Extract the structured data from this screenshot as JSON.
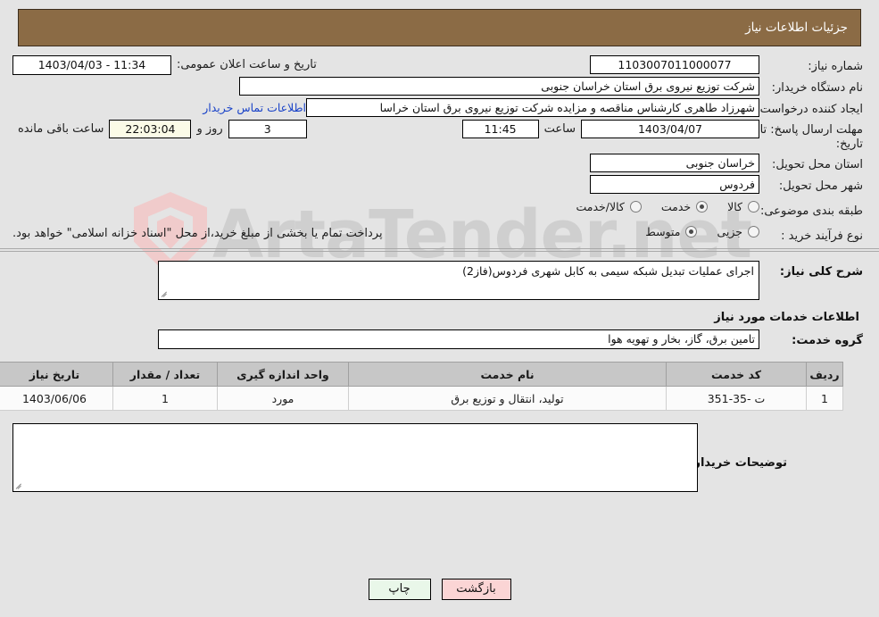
{
  "header": {
    "title": "جزئیات اطلاعات نیاز",
    "bg_color": "#8b6b45",
    "text_color": "#ffffff"
  },
  "watermark": {
    "text": "ArtaTender.net",
    "shield_color": "#f0cbcb",
    "text_color": "#cfcfcf"
  },
  "form": {
    "need_number_label": "شماره نیاز:",
    "need_number_value": "1103007011000077",
    "public_announce_label": "تاریخ و ساعت اعلان عمومی:",
    "public_announce_value": "11:34 - 1403/04/03",
    "buyer_org_label": "نام دستگاه خریدار:",
    "buyer_org_value": "شرکت توزیع نیروی برق استان خراسان جنوبی",
    "creator_label": "ایجاد کننده درخواست:",
    "creator_value": "شهرزاد طاهری کارشناس مناقصه و مزایده شرکت توزیع نیروی برق استان خراسا",
    "buyer_contact_link": "اطلاعات تماس خریدار",
    "deadline_label": "مهلت ارسال پاسخ: تا تاریخ:",
    "deadline_date": "1403/04/07",
    "deadline_hour_label": "ساعت",
    "deadline_time": "11:45",
    "remaining_days": "3",
    "remaining_days_label": "روز و",
    "remaining_clock": "22:03:04",
    "remaining_clock_label": "ساعت باقی مانده",
    "delivery_province_label": "استان محل تحویل:",
    "delivery_province_value": "خراسان جنوبی",
    "delivery_city_label": "شهر محل تحویل:",
    "delivery_city_value": "فردوس",
    "category_label": "طبقه بندی موضوعی:",
    "category_options": [
      {
        "label": "کالا",
        "selected": false
      },
      {
        "label": "خدمت",
        "selected": true
      },
      {
        "label": "کالا/خدمت",
        "selected": false
      }
    ],
    "purchase_type_label": "نوع فرآیند خرید :",
    "purchase_type_options": [
      {
        "label": "جزیی",
        "selected": false
      },
      {
        "label": "متوسط",
        "selected": true
      }
    ],
    "payment_note": "پرداخت تمام یا بخشی از مبلغ خرید،از محل \"اسناد خزانه اسلامی\" خواهد بود."
  },
  "description": {
    "label": "شرح کلی نیاز:",
    "value": "اجرای عملیات تبدیل شبکه سیمی به کابل شهری فردوس(فاز2)"
  },
  "services_section": {
    "title": "اطلاعات خدمات مورد نیاز",
    "group_label": "گروه خدمت:",
    "group_value": "تامین برق، گاز، بخار و تهویه هوا"
  },
  "table": {
    "columns": [
      "ردیف",
      "کد خدمت",
      "نام خدمت",
      "واحد اندازه گیری",
      "تعداد / مقدار",
      "تاریخ نیاز"
    ],
    "rows": [
      {
        "row": "1",
        "code": "ت -35-351",
        "name": "تولید، انتقال و توزیع برق",
        "unit": "مورد",
        "qty": "1",
        "date": "1403/06/06"
      }
    ]
  },
  "buyer_notes": {
    "label": "توضیحات خریدار:",
    "value": ""
  },
  "buttons": {
    "print": "چاپ",
    "back": "بازگشت"
  }
}
